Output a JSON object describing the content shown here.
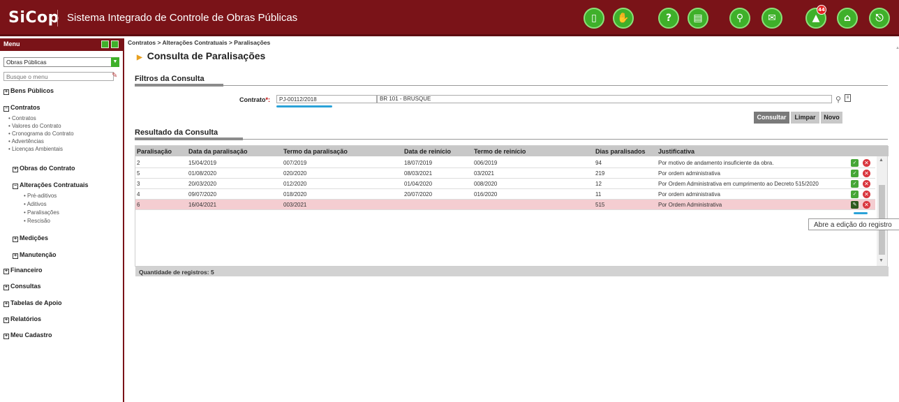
{
  "header": {
    "logo": "SiCop",
    "title": "Sistema Integrado de Controle de Obras Públicas",
    "notification_count": "44",
    "icons": [
      "mobile-icon",
      "handshake-icon",
      "help-icon",
      "book-icon",
      "search-icon",
      "mail-icon",
      "notification-icon",
      "home-icon",
      "logout-icon"
    ]
  },
  "sidebar": {
    "menu_label": "Menu",
    "module": "Obras Públicas",
    "search_placeholder": "Busque o menu",
    "items": {
      "bens": "Bens Públicos",
      "contratos": "Contratos",
      "contratos_subs": [
        "Contratos",
        "Valores do Contrato",
        "Cronograma do Contrato",
        "Advertências",
        "Licenças Ambientais"
      ],
      "obras": "Obras do Contrato",
      "alteracoes": "Alterações Contratuais",
      "alteracoes_subs": [
        "Pré-aditivos",
        "Aditivos",
        "Paralisações",
        "Rescisão"
      ],
      "medicoes": "Medições",
      "manutencao": "Manutenção",
      "financeiro": "Financeiro",
      "consultas": "Consultas",
      "tabelas": "Tabelas de Apoio",
      "relatorios": "Relatórios",
      "cadastro": "Meu Cadastro"
    }
  },
  "breadcrumb": "Contratos > Alterações Contratuais > Paralisações",
  "page_title": "Consulta de Paralisações",
  "filters": {
    "section_title": "Filtros da Consulta",
    "contrato_label": "Contrato",
    "contrato_required": "*:",
    "contrato_value": "PJ-00112/2018",
    "contrato_desc": "BR 101 - BRUSQUE",
    "buttons": {
      "consultar": "Consultar",
      "limpar": "Limpar",
      "novo": "Novo"
    }
  },
  "results": {
    "section_title": "Resultado da Consulta",
    "columns": [
      "Paralisação",
      "Data da paralisação",
      "Termo da paralisação",
      "Data de reinício",
      "Termo de reinício",
      "Dias paralisados",
      "Justificativa"
    ],
    "rows": [
      [
        "2",
        "15/04/2019",
        "007/2019",
        "18/07/2019",
        "006/2019",
        "94",
        "Por motivo de andamento insuficiente da obra."
      ],
      [
        "5",
        "01/08/2020",
        "020/2020",
        "08/03/2021",
        "03/2021",
        "219",
        "Por ordem administrativa"
      ],
      [
        "3",
        "20/03/2020",
        "012/2020",
        "01/04/2020",
        "008/2020",
        "12",
        "Por Ordem Administrativa em cumprimento ao Decreto 515/2020"
      ],
      [
        "4",
        "09/07/2020",
        "018/2020",
        "20/07/2020",
        "016/2020",
        "11",
        "Por ordem administrativa"
      ],
      [
        "6",
        "16/04/2021",
        "003/2021",
        "",
        "",
        "515",
        "Por Ordem Administrativa"
      ]
    ],
    "footer": "Quantidade de registros: 5",
    "tooltip": "Abre a edição do registro"
  }
}
